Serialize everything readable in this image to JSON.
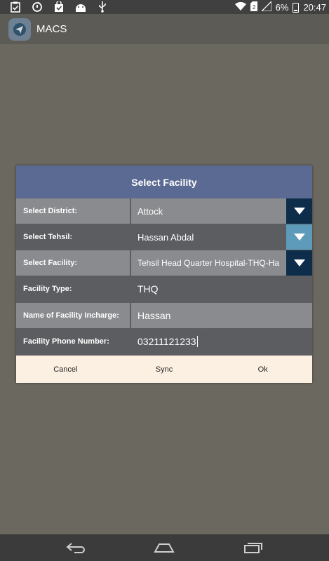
{
  "statusbar": {
    "left_icons": [
      "clipboard-check-icon",
      "sync-icon",
      "shopping-bag-icon",
      "android-icon",
      "usb-icon"
    ],
    "right_icons": [
      "wifi-icon",
      "sim-icon",
      "signal-icon",
      "battery-icon"
    ],
    "battery_percent": "6%",
    "time": "20:47"
  },
  "appbar": {
    "title": "MACS",
    "icon": "paper-plane-icon"
  },
  "dialog": {
    "title": "Select Facility",
    "rows": [
      {
        "label": "Select District:",
        "value": "Attock",
        "type": "dropdown"
      },
      {
        "label": "Select Tehsil:",
        "value": "Hassan Abdal",
        "type": "dropdown"
      },
      {
        "label": "Select Facility:",
        "value": "Tehsil Head Quarter Hospital-THQ-Ha",
        "type": "dropdown"
      },
      {
        "label": "Facility Type:",
        "value": "THQ",
        "type": "text"
      },
      {
        "label": "Name of Facility Incharge:",
        "value": "Hassan",
        "type": "input"
      },
      {
        "label": "Facility Phone Number:",
        "value": "03211121233",
        "type": "input"
      }
    ],
    "buttons": {
      "cancel": "Cancel",
      "sync": "Sync",
      "ok": "Ok"
    }
  },
  "navbar": {
    "icons": [
      "back-icon",
      "home-icon",
      "recents-icon"
    ]
  },
  "colors": {
    "dialog_title_bg": "#5a6a92",
    "row_dark": "#5b5d60",
    "row_light": "#8a8b8e",
    "dropdown_dark": "#0e2d4a",
    "dropdown_light": "#5e9ab9",
    "button_bar": "#fcf0e3"
  }
}
